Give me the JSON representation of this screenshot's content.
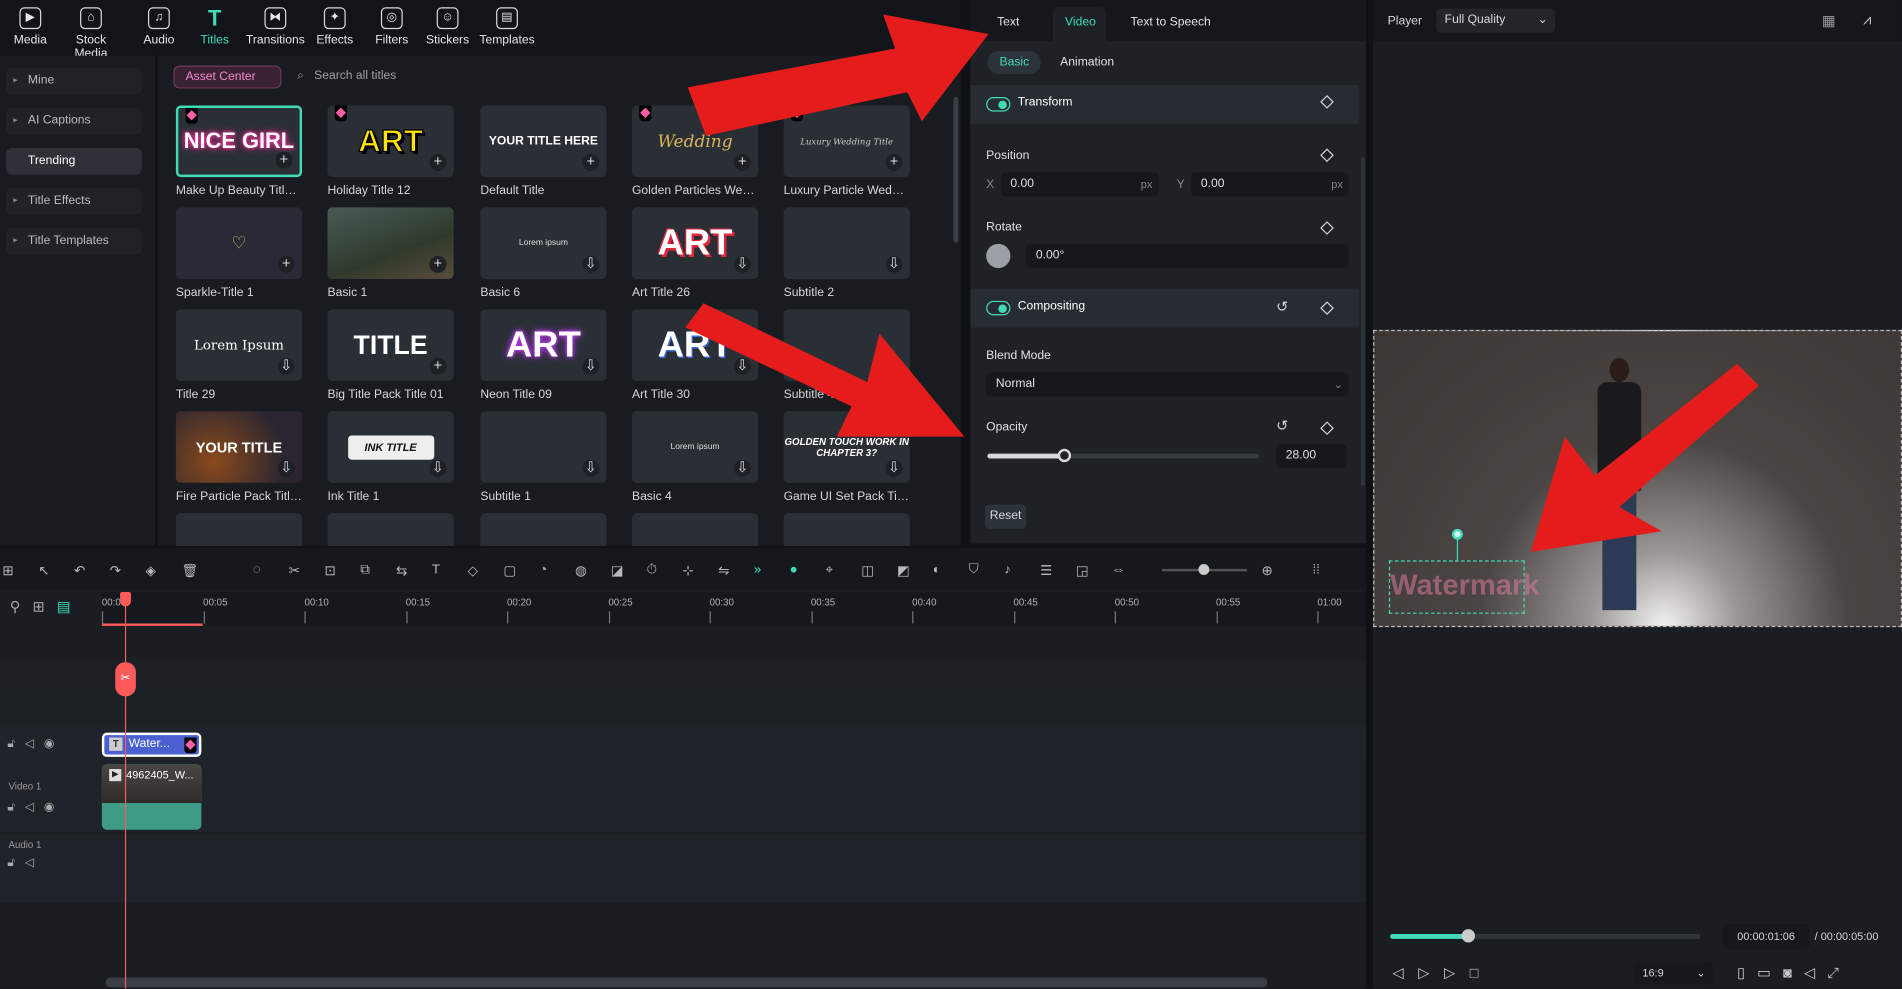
{
  "toolbar": {
    "items": [
      {
        "label": "Media",
        "icon": "media-icon",
        "glyph": "▶"
      },
      {
        "label": "Stock Media",
        "icon": "stock-media-icon",
        "glyph": "⌂"
      },
      {
        "label": "Audio",
        "icon": "audio-icon",
        "glyph": "♫"
      },
      {
        "label": "Titles",
        "icon": "titles-icon",
        "glyph": "T",
        "active": true
      },
      {
        "label": "Transitions",
        "icon": "transitions-icon",
        "glyph": "⧓"
      },
      {
        "label": "Effects",
        "icon": "effects-icon",
        "glyph": "✦"
      },
      {
        "label": "Filters",
        "icon": "filters-icon",
        "glyph": "◎"
      },
      {
        "label": "Stickers",
        "icon": "stickers-icon",
        "glyph": "☺"
      },
      {
        "label": "Templates",
        "icon": "templates-icon",
        "glyph": "▤"
      }
    ]
  },
  "sidebar": {
    "items": [
      {
        "label": "Mine"
      },
      {
        "label": "AI Captions"
      },
      {
        "label": "Trending",
        "active": true
      },
      {
        "label": "Title Effects"
      },
      {
        "label": "Title Templates"
      }
    ]
  },
  "library": {
    "asset_center": "Asset Center",
    "search_placeholder": "Search all titles",
    "cards": [
      {
        "label": "Make Up Beauty Title 01",
        "thumb": "NICE GIRL",
        "style": "t-nice",
        "premium": true,
        "action": "add",
        "selected": true
      },
      {
        "label": "Holiday Title 12",
        "thumb": "ART",
        "style": "t-art",
        "premium": true,
        "action": "add"
      },
      {
        "label": "Default Title",
        "thumb": "YOUR TITLE HERE",
        "style": "t-plain",
        "action": "add"
      },
      {
        "label": "Golden Particles Wed...",
        "thumb": "Wedding",
        "style": "t-gold",
        "premium": true,
        "action": "add"
      },
      {
        "label": "Luxury Particle Weddi...",
        "thumb": "Luxury Wedding Title",
        "style": "t-faint",
        "premium": true,
        "action": "add"
      },
      {
        "label": "Sparkle-Title 1",
        "thumb": "♡",
        "style": "t-gold",
        "bg": "b-spark",
        "action": "add"
      },
      {
        "label": "Basic 1",
        "thumb": "",
        "style": "t-plain",
        "bg": "b-photo",
        "action": "add"
      },
      {
        "label": "Basic 6",
        "thumb": "Lorem ipsum",
        "style": "t-small",
        "action": "download"
      },
      {
        "label": "Art Title 26",
        "thumb": "ART",
        "style": "t-red",
        "action": "download"
      },
      {
        "label": "Subtitle 2",
        "thumb": "",
        "style": "t-small",
        "action": "download"
      },
      {
        "label": "Title 29",
        "thumb": "Lorem Ipsum",
        "style": "t-serif",
        "action": "download"
      },
      {
        "label": "Big Title Pack Title 01",
        "thumb": "TITLE",
        "style": "t-title",
        "action": "add"
      },
      {
        "label": "Neon Title 09",
        "thumb": "ART",
        "style": "t-neon",
        "action": "download"
      },
      {
        "label": "Art Title 30",
        "thumb": "ART",
        "style": "t-white",
        "action": "download"
      },
      {
        "label": "Subtitle 4",
        "thumb": "",
        "style": "t-small",
        "action": "download"
      },
      {
        "label": "Fire Particle Pack Title ...",
        "thumb": "YOUR TITLE",
        "style": "t-fire",
        "bg": "b-fire",
        "action": "download"
      },
      {
        "label": "Ink Title 1",
        "thumb": "INK TITLE",
        "style": "t-ink",
        "action": "download"
      },
      {
        "label": "Subtitle 1",
        "thumb": "",
        "style": "t-small",
        "action": "download"
      },
      {
        "label": "Basic 4",
        "thumb": "Lorem ipsum",
        "style": "t-small",
        "action": "download"
      },
      {
        "label": "Game UI Set Pack Title...",
        "thumb": "GOLDEN TOUCH WORK IN CHAPTER 3?",
        "style": "t-game",
        "action": "download"
      }
    ]
  },
  "props": {
    "tabs": [
      "Text",
      "Video",
      "Text to Speech"
    ],
    "active_tab": "Video",
    "subtabs": [
      "Basic",
      "Animation"
    ],
    "transform": "Transform",
    "position": "Position",
    "x_label": "X",
    "x_value": "0.00",
    "y_label": "Y",
    "y_value": "0.00",
    "unit": "px",
    "rotate": "Rotate",
    "rotate_value": "0.00°",
    "compositing": "Compositing",
    "blend_mode": "Blend Mode",
    "blend_value": "Normal",
    "opacity": "Opacity",
    "opacity_value": "28.00",
    "opacity_fraction": 0.28,
    "reset": "Reset"
  },
  "player": {
    "label": "Player",
    "quality": "Full Quality",
    "watermark": "Watermark",
    "current_time": "00:00:01:06",
    "total_time": "/ 00:00:05:00",
    "progress": 0.25,
    "ratio": "16:9"
  },
  "timeline": {
    "ticks": [
      "00:00",
      "00:05",
      "00:10",
      "00:15",
      "00:20",
      "00:25",
      "00:30",
      "00:35",
      "00:40",
      "00:45",
      "00:50",
      "00:55",
      "01:00"
    ],
    "title_clip": "Water...",
    "video_clip": "4962405_W...",
    "video_track": "Video 1",
    "audio_track": "Audio 1"
  },
  "colors": {
    "accent": "#3fdcb7",
    "annotation": "#e51c1c",
    "playhead": "#ff5a5a"
  }
}
